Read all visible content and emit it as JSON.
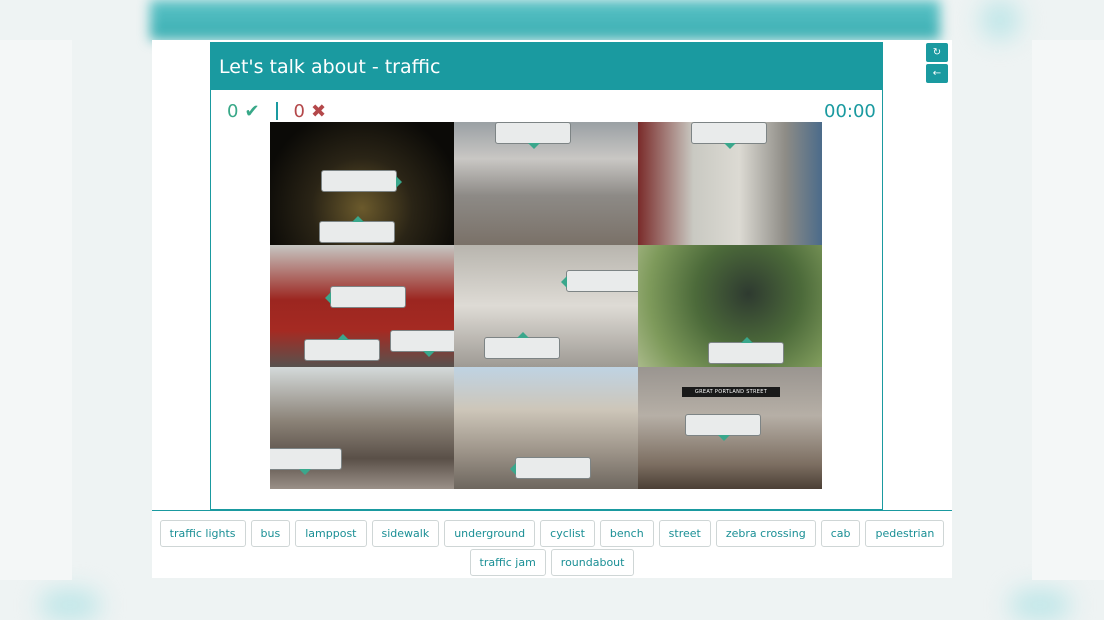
{
  "title": "Let's talk about - traffic",
  "score": {
    "correct": "0",
    "wrong": "0",
    "correct_icon": "check-icon",
    "wrong_icon": "x-icon"
  },
  "timer": "00:00",
  "side_buttons": [
    {
      "icon": "refresh-icon"
    },
    {
      "icon": "exit-icon"
    }
  ],
  "photo_sign_text": "GREAT PORTLAND STREET",
  "word_bank": [
    "traffic lights",
    "bus",
    "lamppost",
    "sidewalk",
    "underground",
    "cyclist",
    "bench",
    "street",
    "zebra crossing",
    "cab",
    "pedestrian",
    "traffic jam",
    "roundabout"
  ],
  "colors": {
    "accent": "#1a9aa0",
    "correct": "#38a888",
    "wrong": "#b4484a"
  }
}
